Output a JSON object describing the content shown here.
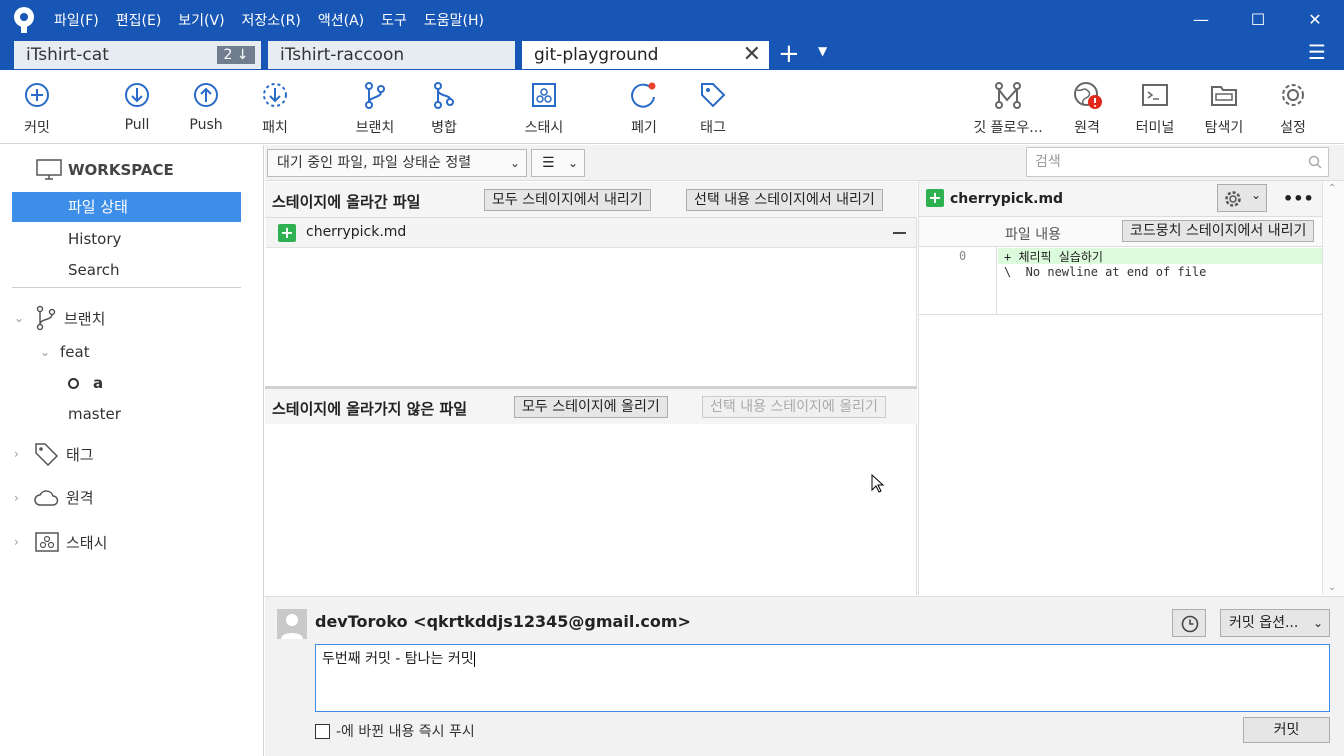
{
  "menu": [
    "파일(F)",
    "편집(E)",
    "보기(V)",
    "저장소(R)",
    "액션(A)",
    "도구",
    "도움말(H)"
  ],
  "window": {
    "minimize": "—",
    "maximize": "☐",
    "close": "✕"
  },
  "tabs": [
    {
      "label": "iTshirt-cat",
      "badge": "2 ↓"
    },
    {
      "label": "iTshirt-raccoon"
    },
    {
      "label": "git-playground",
      "close": "✕"
    }
  ],
  "tab_add": "+",
  "tab_more": "▼",
  "hamburger": "☰",
  "toolbar": {
    "commit": "커밋",
    "pull": "Pull",
    "push": "Push",
    "fetch": "패치",
    "branch": "브랜치",
    "merge": "병합",
    "stash": "스태시",
    "discard": "폐기",
    "tag": "태그",
    "gitflow": "깃 플로우...",
    "remote": "원격",
    "terminal": "터미널",
    "explorer": "탐색기",
    "settings": "설정"
  },
  "sidebar": {
    "workspace": "WORKSPACE",
    "file_status": "파일 상태",
    "history": "History",
    "search": "Search",
    "branches": "브랜치",
    "feat": "feat",
    "branch_a": "a",
    "master": "master",
    "tags": "태그",
    "remotes": "원격",
    "stashes": "스태시"
  },
  "filter": {
    "sort": "대기 중인 파일, 파일 상태순 정렬",
    "view": "☰",
    "search_placeholder": "검색"
  },
  "staged": {
    "title": "스테이지에 올라간 파일",
    "unstage_all": "모두 스테이지에서 내리기",
    "unstage_sel": "선택 내용 스테이지에서 내리기",
    "files": [
      {
        "name": "cherrypick.md",
        "status": "+"
      }
    ]
  },
  "unstaged": {
    "title": "스테이지에 올라가지 않은 파일",
    "stage_all": "모두 스테이지에 올리기",
    "stage_sel": "선택 내용 스테이지에 올리기"
  },
  "diff": {
    "filename": "cherrypick.md",
    "more": "•••",
    "hunk_title": "파일 내용",
    "hunk_btn": "코드뭉치 스테이지에서 내리기",
    "line_no": "0",
    "line1": "+ 체리픽 실습하기",
    "line2": "\\  No newline at end of file"
  },
  "commit": {
    "author": "devToroko <qkrtkddjs12345@gmail.com>",
    "options": "커밋 옵션...",
    "message": "두번째 커밋 - 탐나는 커밋",
    "push_label": "-에 바뀐 내용 즉시 푸시",
    "commit_btn": "커밋"
  }
}
